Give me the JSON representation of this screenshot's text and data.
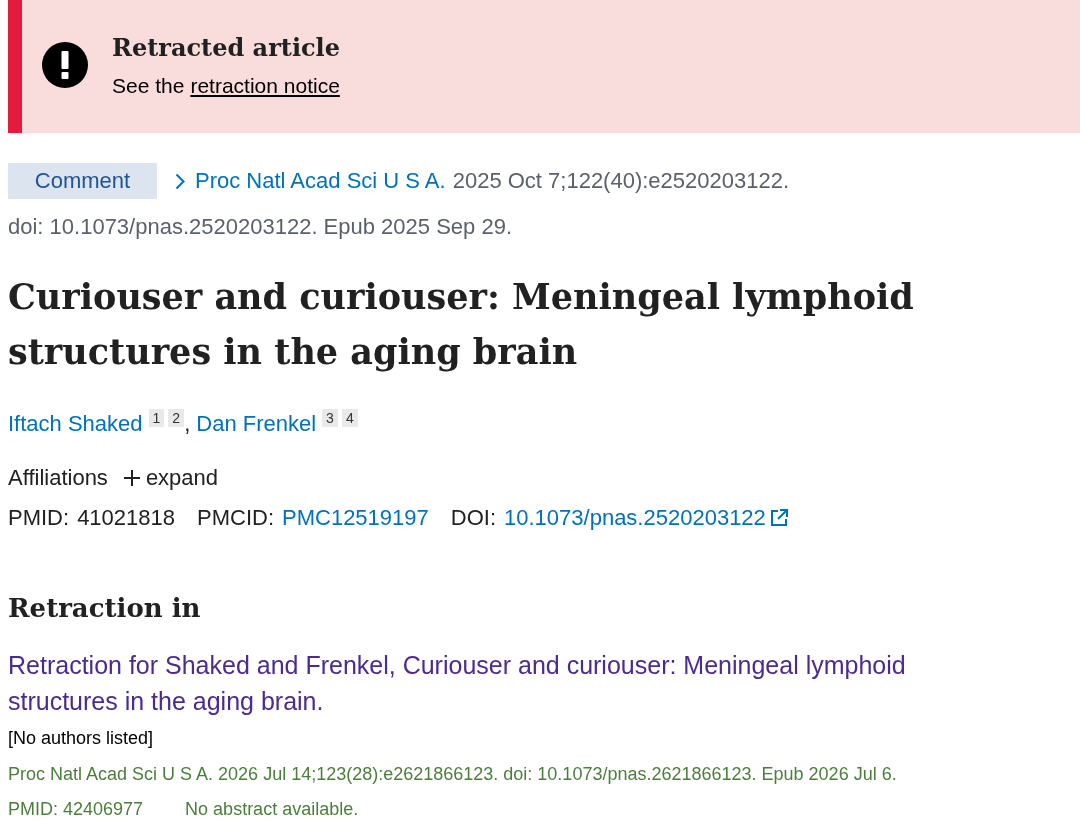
{
  "retraction_banner": {
    "title": "Retracted article",
    "text": "See the",
    "link": "retraction notice"
  },
  "article_type": "Comment",
  "citation": {
    "journal": "Proc Natl Acad Sci U S A.",
    "details": "2025 Oct 7;122(40):e2520203122.",
    "doi_line": "doi: 10.1073/pnas.2520203122. Epub 2025 Sep 29."
  },
  "title": "Curiouser and curiouser: Meningeal lymphoid structures in the aging brain",
  "authors": [
    {
      "name": "Iftach Shaked",
      "affiliations": [
        "1",
        "2"
      ],
      "separator": ","
    },
    {
      "name": "Dan Frenkel",
      "affiliations": [
        "3",
        "4"
      ]
    }
  ],
  "affiliations": {
    "label": "Affiliations",
    "toggle": "expand",
    "expanded": false
  },
  "identifiers": [
    {
      "kind": "text",
      "label": "PMID:",
      "value": "41021818"
    },
    {
      "kind": "link",
      "label": "PMCID:",
      "value": "PMC12519197"
    },
    {
      "kind": "external_link",
      "label": "DOI:",
      "value": "10.1073/pnas.2520203122"
    }
  ],
  "retraction_in": {
    "heading": "Retraction in",
    "items": [
      {
        "title": "Retraction for Shaked and Frenkel, Curiouser and curiouser: Meningeal lymphoid structures in the aging brain.",
        "authors": "[No authors listed]",
        "citation": "Proc Natl Acad Sci U S A. 2026 Jul 14;123(28):e2621866123. doi: 10.1073/pnas.2621866123. Epub 2026 Jul 6.",
        "pmid": "PMID: 42406977",
        "abstract_note": "No abstract available."
      }
    ]
  }
}
